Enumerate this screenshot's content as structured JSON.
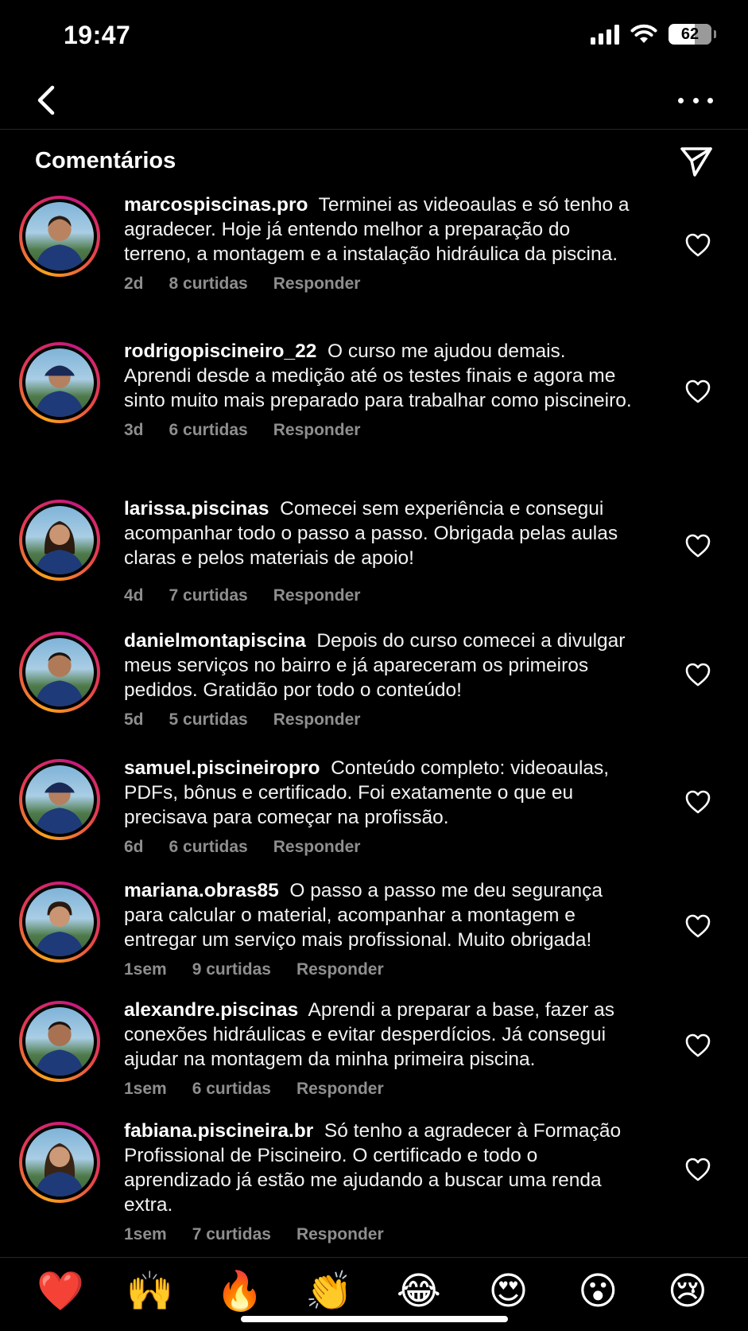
{
  "status_bar": {
    "time": "19:47",
    "battery": "62"
  },
  "header": {
    "title": "Comentários"
  },
  "comments": [
    {
      "username": "marcospiscinas.pro",
      "text": "Terminei as videoaulas e só tenho a agradecer.  Hoje já entendo melhor a preparação do terreno, a montagem e a instalação hidráulica da piscina.",
      "time": "2d",
      "likes": "8 curtidas",
      "reply": "Responder"
    },
    {
      "username": "rodrigopiscineiro_22",
      "text": "O curso me ajudou demais. Aprendi desde a medição até os testes finais e agora me sinto muito mais preparado para trabalhar como piscineiro.",
      "time": "3d",
      "likes": "6 curtidas",
      "reply": "Responder"
    },
    {
      "username": "larissa.piscinas",
      "text": "Comecei sem experiência e consegui acompanhar todo o passo a passo. Obrigada pelas aulas claras e pelos materiais de apoio!",
      "time": "4d",
      "likes": "7 curtidas",
      "reply": "Responder"
    },
    {
      "username": "danielmontapiscina",
      "text": "Depois do curso comecei a divulgar meus serviços no bairro e já apareceram os primeiros pedidos. Gratidão por todo o conteúdo!",
      "time": "5d",
      "likes": "5 curtidas",
      "reply": "Responder"
    },
    {
      "username": "samuel.piscineiropro",
      "text": "Conteúdo completo: videoaulas, PDFs, bônus e certificado. Foi exatamente o que eu precisava para começar na profissão.",
      "time": "6d",
      "likes": "6 curtidas",
      "reply": "Responder"
    },
    {
      "username": "mariana.obras85",
      "text": "O passo a passo me deu segurança para calcular o material, acompanhar a montagem e entregar um serviço mais profissional. Muito obrigada!",
      "time": "1sem",
      "likes": "9 curtidas",
      "reply": "Responder"
    },
    {
      "username": "alexandre.piscinas",
      "text": "Aprendi a preparar a base, fazer as conexões hidráulicas e evitar desperdícios. Já consegui ajudar na montagem da minha primeira piscina.",
      "time": "1sem",
      "likes": "6 curtidas",
      "reply": "Responder"
    },
    {
      "username": "fabiana.piscineira.br",
      "text": "Só tenho a agradecer à Formação Profissional de Piscineiro. O certificado e todo o aprendizado já estão me ajudando a buscar uma renda extra.",
      "time": "1sem",
      "likes": "7 curtidas",
      "reply": "Responder"
    }
  ],
  "emojis": [
    "❤️",
    "🙌",
    "🔥",
    "👏",
    "😂",
    "😍",
    "😮",
    "😢"
  ]
}
